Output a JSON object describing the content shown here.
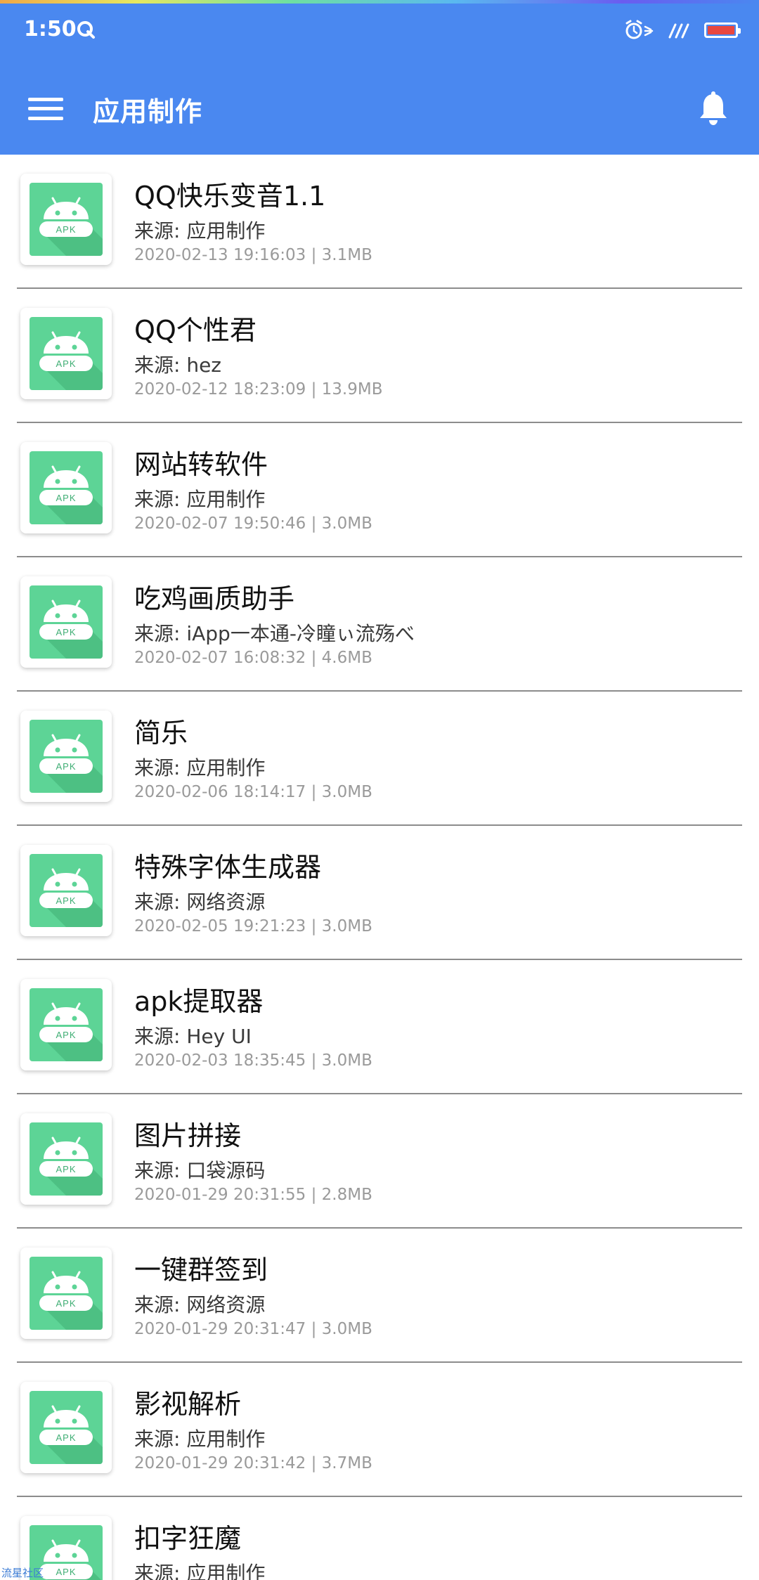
{
  "status_bar": {
    "time": "1:50"
  },
  "app_bar": {
    "title": "应用制作"
  },
  "icon_badge": "APK",
  "apps": [
    {
      "name": "QQ快乐变音1.1",
      "source": "来源: 应用制作",
      "meta": "2020-02-13 19:16:03 | 3.1MB"
    },
    {
      "name": "QQ个性君",
      "source": "来源: hez",
      "meta": "2020-02-12 18:23:09 | 13.9MB"
    },
    {
      "name": "网站转软件",
      "source": "来源: 应用制作",
      "meta": "2020-02-07 19:50:46 | 3.0MB"
    },
    {
      "name": "吃鸡画质助手",
      "source": "来源: iApp一本通-冷瞳ぃ流殇べ",
      "meta": "2020-02-07 16:08:32 | 4.6MB"
    },
    {
      "name": "简乐",
      "source": "来源: 应用制作",
      "meta": "2020-02-06 18:14:17 | 3.0MB"
    },
    {
      "name": "特殊字体生成器",
      "source": "来源: 网络资源",
      "meta": "2020-02-05 19:21:23 | 3.0MB"
    },
    {
      "name": "apk提取器",
      "source": "来源: Hey UI",
      "meta": "2020-02-03 18:35:45 | 3.0MB"
    },
    {
      "name": "图片拼接",
      "source": "来源: 口袋源码",
      "meta": "2020-01-29 20:31:55 | 2.8MB"
    },
    {
      "name": "一键群签到",
      "source": "来源: 网络资源",
      "meta": "2020-01-29 20:31:47 | 3.0MB"
    },
    {
      "name": "影视解析",
      "source": "来源: 应用制作",
      "meta": "2020-01-29 20:31:42 | 3.7MB"
    },
    {
      "name": "扣字狂魔",
      "source": "来源: 应用制作",
      "meta": ""
    }
  ],
  "watermark": "流星社区",
  "colors": {
    "header_blue": "#4a88f0",
    "icon_green": "#5dd496",
    "battery_red": "#e8473f"
  },
  "icons": {
    "menu": "hamburger-menu-icon",
    "bell": "bell-icon",
    "app": "android-apk-icon",
    "status_q": "q-notification-icon",
    "alarm": "alarm-clock-icon",
    "signal": "signal-icon",
    "battery": "battery-icon"
  }
}
